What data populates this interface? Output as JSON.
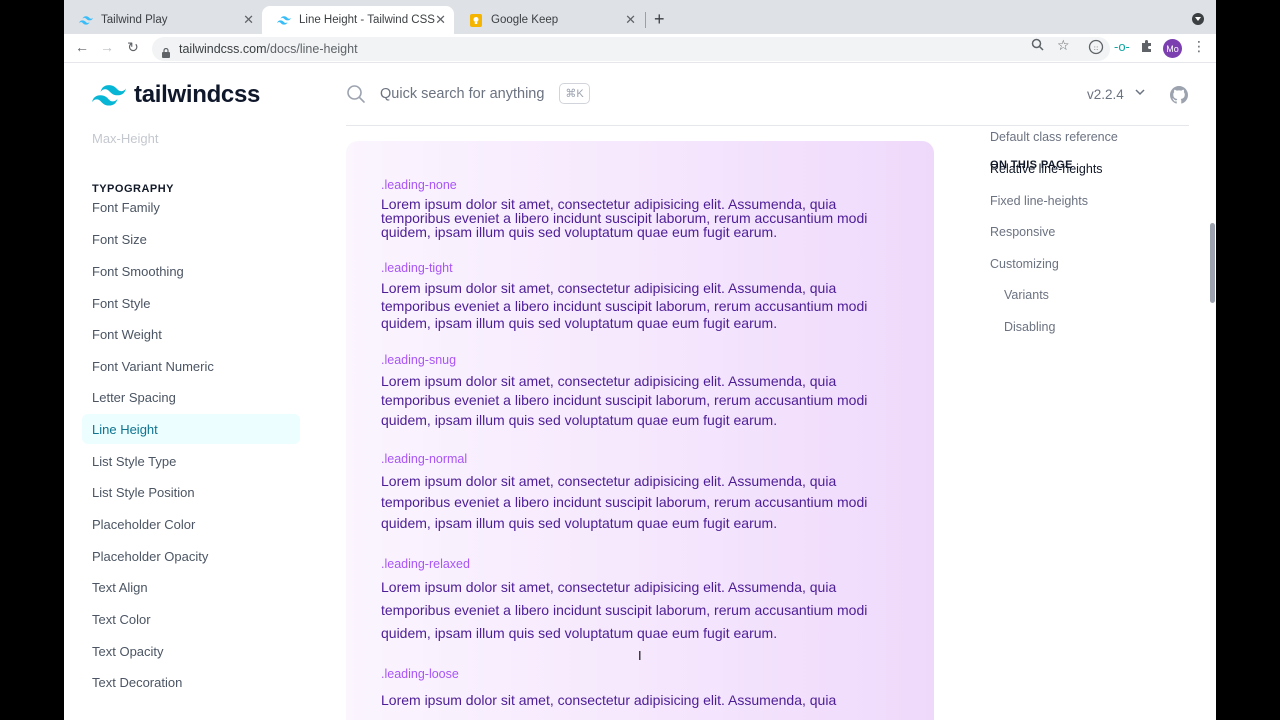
{
  "browser": {
    "tabs": [
      {
        "title": "Tailwind Play",
        "icon": "tailwind-icon"
      },
      {
        "title": "Line Height - Tailwind CSS",
        "icon": "tailwind-icon"
      },
      {
        "title": "Google Keep",
        "icon": "keep-icon"
      }
    ],
    "url_host": "tailwindcss.com",
    "url_path": "/docs/line-height",
    "profile_initials": "Mo"
  },
  "header": {
    "logo_text": "tailwindcss",
    "search_placeholder": "Quick search for anything",
    "search_shortcut": "⌘K",
    "version": "v2.2.4"
  },
  "sidebar": {
    "faded_item": "Max-Height",
    "section_heading": "TYPOGRAPHY",
    "items": [
      {
        "label": "Font Family"
      },
      {
        "label": "Font Size"
      },
      {
        "label": "Font Smoothing"
      },
      {
        "label": "Font Style"
      },
      {
        "label": "Font Weight"
      },
      {
        "label": "Font Variant Numeric"
      },
      {
        "label": "Letter Spacing"
      },
      {
        "label": "Line Height",
        "active": true
      },
      {
        "label": "List Style Type"
      },
      {
        "label": "List Style Position"
      },
      {
        "label": "Placeholder Color"
      },
      {
        "label": "Placeholder Opacity"
      },
      {
        "label": "Text Align"
      },
      {
        "label": "Text Color"
      },
      {
        "label": "Text Opacity"
      },
      {
        "label": "Text Decoration"
      }
    ]
  },
  "demo": {
    "blocks": [
      {
        "label": ".leading-none",
        "text": "Lorem ipsum dolor sit amet, consectetur adipisicing elit. Assumenda, quia temporibus eveniet a libero incidunt suscipit laborum, rerum accusantium modi quidem, ipsam illum quis sed voluptatum quae eum fugit earum."
      },
      {
        "label": ".leading-tight",
        "text": "Lorem ipsum dolor sit amet, consectetur adipisicing elit. Assumenda, quia temporibus eveniet a libero incidunt suscipit laborum, rerum accusantium modi quidem, ipsam illum quis sed voluptatum quae eum fugit earum."
      },
      {
        "label": ".leading-snug",
        "text": "Lorem ipsum dolor sit amet, consectetur adipisicing elit. Assumenda, quia temporibus eveniet a libero incidunt suscipit laborum, rerum accusantium modi quidem, ipsam illum quis sed voluptatum quae eum fugit earum."
      },
      {
        "label": ".leading-normal",
        "text": "Lorem ipsum dolor sit amet, consectetur adipisicing elit. Assumenda, quia temporibus eveniet a libero incidunt suscipit laborum, rerum accusantium modi quidem, ipsam illum quis sed voluptatum quae eum fugit earum."
      },
      {
        "label": ".leading-relaxed",
        "text": "Lorem ipsum dolor sit amet, consectetur adipisicing elit. Assumenda, quia temporibus eveniet a libero incidunt suscipit laborum, rerum accusantium modi quidem, ipsam illum quis sed voluptatum quae eum fugit earum."
      },
      {
        "label": ".leading-loose",
        "text": "Lorem ipsum dolor sit amet, consectetur adipisicing elit. Assumenda, quia"
      }
    ]
  },
  "toc": {
    "heading": "ON THIS PAGE",
    "items": [
      {
        "label": "Default class reference"
      },
      {
        "label": "Relative line-heights",
        "active": true
      },
      {
        "label": "Fixed line-heights"
      },
      {
        "label": "Responsive"
      },
      {
        "label": "Customizing"
      },
      {
        "label": "Variants",
        "indent": true
      },
      {
        "label": "Disabling",
        "indent": true
      }
    ]
  },
  "colors": {
    "brand_accent": "#38bdf8",
    "active_nav_bg": "#ecfeff",
    "active_nav_text": "#0e7490",
    "demo_label": "#a855f7",
    "demo_text": "#4c1d95"
  }
}
